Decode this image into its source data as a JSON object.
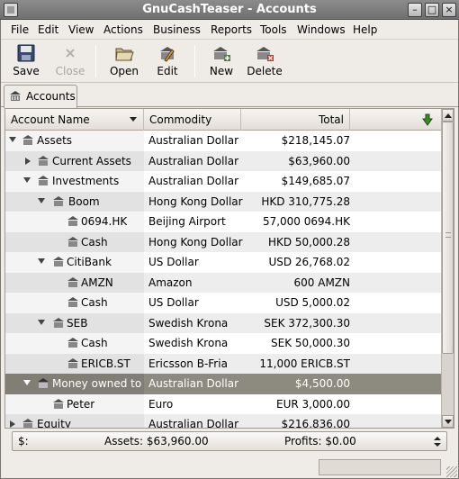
{
  "window": {
    "title": "GnuCashTeaser - Accounts"
  },
  "menu": [
    "File",
    "Edit",
    "View",
    "Actions",
    "Business",
    "Reports",
    "Tools",
    "Windows",
    "Help"
  ],
  "toolbar": {
    "save": "Save",
    "close": "Close",
    "open": "Open",
    "edit": "Edit",
    "new": "New",
    "delete": "Delete"
  },
  "tab": {
    "label": "Accounts"
  },
  "columns": {
    "name": "Account Name",
    "commodity": "Commodity",
    "total": "Total"
  },
  "accounts": [
    {
      "name": "Assets",
      "commodity": "Australian Dollar",
      "total": "$218,145.07"
    },
    {
      "name": "Current Assets",
      "commodity": "Australian Dollar",
      "total": "$63,960.00"
    },
    {
      "name": "Investments",
      "commodity": "Australian Dollar",
      "total": "$149,685.07"
    },
    {
      "name": "Boom",
      "commodity": "Hong Kong Dollar",
      "total": "HKD 310,775.28"
    },
    {
      "name": "0694.HK",
      "commodity": "Beijing Airport",
      "total": "57,000 0694.HK"
    },
    {
      "name": "Cash",
      "commodity": "Hong Kong Dollar",
      "total": "HKD 50,000.28"
    },
    {
      "name": "CitiBank",
      "commodity": "US Dollar",
      "total": "USD 26,768.02"
    },
    {
      "name": "AMZN",
      "commodity": "Amazon",
      "total": "600 AMZN"
    },
    {
      "name": "Cash",
      "commodity": "US Dollar",
      "total": "USD 5,000.02"
    },
    {
      "name": "SEB",
      "commodity": "Swedish Krona",
      "total": "SEK 372,300.30"
    },
    {
      "name": "Cash",
      "commodity": "Swedish Krona",
      "total": "SEK 50,000.30"
    },
    {
      "name": "ERICB.ST",
      "commodity": "Ericsson B-Fria",
      "total": "11,000 ERICB.ST"
    },
    {
      "name": "Money owned to n",
      "commodity": "Australian Dollar",
      "total": "$4,500.00"
    },
    {
      "name": "Peter",
      "commodity": "Euro",
      "total": "EUR 3,000.00"
    },
    {
      "name": "Equity",
      "commodity": "Australian Dollar",
      "total": "$216,836.00"
    }
  ],
  "summary": {
    "currency": "$:",
    "assets": "Assets: $63,960.00",
    "profits": "Profits: $0.00"
  },
  "colors": {
    "selected_row": "#8d8a7f",
    "titlebar": "#7d7d7d"
  }
}
